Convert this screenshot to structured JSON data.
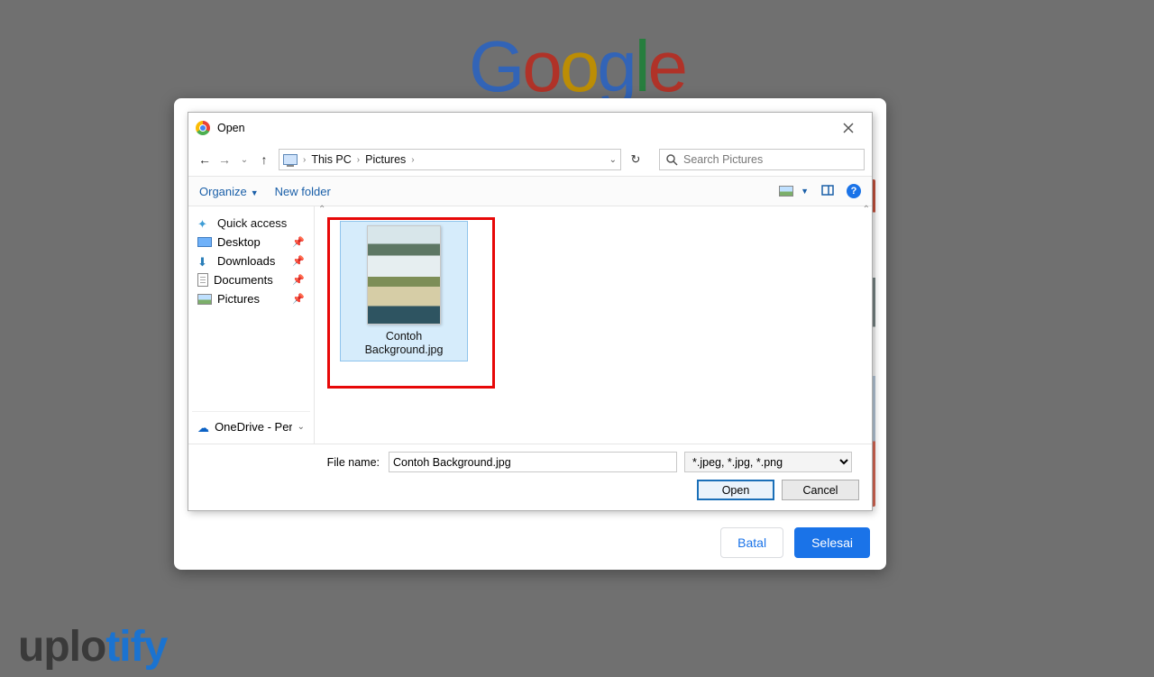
{
  "google_logo_letters": [
    "G",
    "o",
    "o",
    "g",
    "l",
    "e"
  ],
  "google_logo_colors": [
    "#4285F4",
    "#EA4335",
    "#FBBC05",
    "#4285F4",
    "#34A853",
    "#EA4335"
  ],
  "watermark": {
    "prefix": "uplo",
    "suffix": "tify"
  },
  "card": {
    "cancel_label": "Batal",
    "done_label": "Selesai"
  },
  "dialog": {
    "title": "Open",
    "path": {
      "root": "This PC",
      "sub": "Pictures"
    },
    "search_placeholder": "Search Pictures",
    "toolbar": {
      "organize": "Organize",
      "newfolder": "New folder"
    },
    "sidebar": {
      "quick_access": "Quick access",
      "desktop": "Desktop",
      "downloads": "Downloads",
      "documents": "Documents",
      "pictures": "Pictures",
      "onedrive": "OneDrive - Persor"
    },
    "file": {
      "name_line1": "Contoh",
      "name_line2": "Background.jpg"
    },
    "filename_label": "File name:",
    "filename_value": "Contoh Background.jpg",
    "filter": "*.jpeg, *.jpg, *.png",
    "open": "Open",
    "cancel": "Cancel"
  }
}
